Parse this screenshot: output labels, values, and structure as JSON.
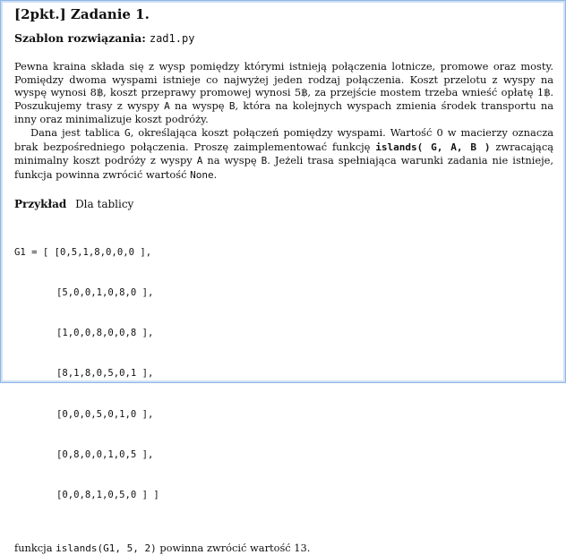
{
  "header": {
    "points": "[2pkt.]",
    "task": "Zadanie 1."
  },
  "template": {
    "label": "Szablon rozwiązania:",
    "file": "zad1.py"
  },
  "p1": {
    "s1": "Pewna kraina składa się z wysp pomiędzy którymi istnieją połączenia lotnicze, promowe oraz mosty. Pomiędzy dwoma wyspami istnieje co najwyżej jeden rodzaj połączenia. Koszt przelotu z wyspy na wyspę wynosi ",
    "c1": "8฿",
    "s2": ", koszt przeprawy promowej wynosi ",
    "c2": "5฿",
    "s3": ", za przejście mostem trzeba wnieść opłatę ",
    "c3": "1฿",
    "s4": ". Poszukujemy trasy z wyspy ",
    "a": "A",
    "s5": " na wyspę ",
    "b": "B",
    "s6": ", która na kolejnych wyspach zmienia środek transportu na inny oraz minimalizuje koszt podróży."
  },
  "p2": {
    "s1": "Dana jest tablica ",
    "g": "G",
    "s2": ", określająca koszt połączeń pomiędzy wyspami. Wartość 0 w macierzy oznacza brak bezpośredniego połączenia. Proszę zaimplementować funkcję ",
    "fn": "islands( G, A, B )",
    "s3": " zwracającą minimalny koszt podróży z wyspy ",
    "a": "A",
    "s4": " na wyspę ",
    "b": "B",
    "s5": ". Jeżeli trasa spełniająca warunki zadania nie istnieje, funkcja powinna zwrócić wartość ",
    "none": "None",
    "s6": "."
  },
  "example": {
    "header": "Przykład",
    "text": "Dla tablicy"
  },
  "code": {
    "line1_prefix": "G1 = [ ",
    "rows": [
      "[0,5,1,8,0,0,0 ],",
      "[5,0,0,1,0,8,0 ],",
      "[1,0,0,8,0,0,8 ],",
      "[8,1,8,0,5,0,1 ],",
      "[0,0,0,5,0,1,0 ],",
      "[0,8,0,0,1,0,5 ],",
      "[0,0,8,1,0,5,0 ] ]"
    ]
  },
  "result": {
    "s1": "funkcja ",
    "call": "islands(G1, 5, 2)",
    "s2": " powinna zwrócić wartość 13."
  }
}
